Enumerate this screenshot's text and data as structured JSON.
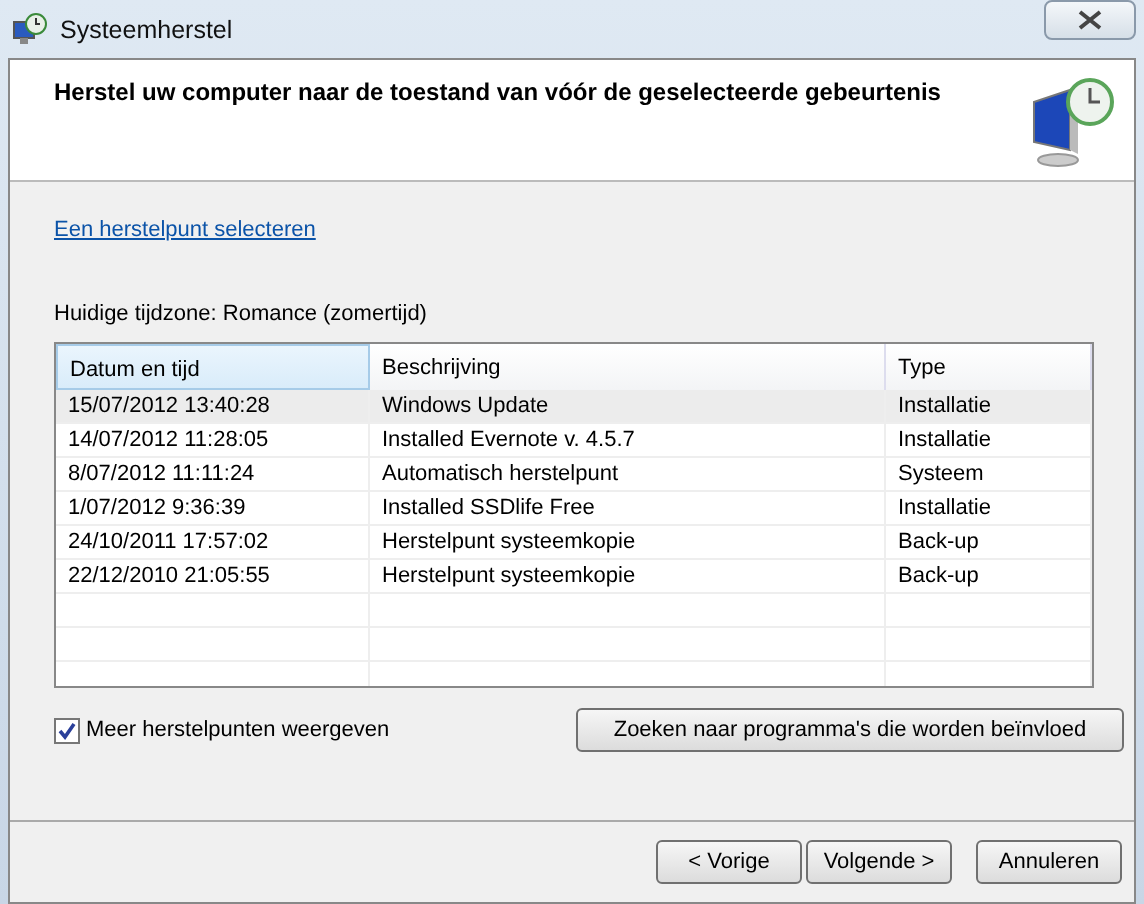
{
  "window": {
    "title": "Systeemherstel"
  },
  "heading": "Herstel uw computer naar de toestand van vóór de geselecteerde gebeurtenis",
  "link": "Een herstelpunt selecteren",
  "timezone": "Huidige tijdzone: Romance (zomertijd)",
  "table": {
    "columns": [
      {
        "label": "Datum en tijd",
        "sorted": true
      },
      {
        "label": "Beschrijving",
        "sorted": false
      },
      {
        "label": "Type",
        "sorted": false
      }
    ],
    "rows": [
      {
        "cells": [
          "15/07/2012 13:40:28",
          "Windows Update",
          "Installatie"
        ],
        "selected": true
      },
      {
        "cells": [
          "14/07/2012 11:28:05",
          "Installed Evernote v. 4.5.7",
          "Installatie"
        ],
        "selected": false
      },
      {
        "cells": [
          "8/07/2012 11:11:24",
          "Automatisch herstelpunt",
          "Systeem"
        ],
        "selected": false
      },
      {
        "cells": [
          "1/07/2012 9:36:39",
          "Installed SSDlife Free",
          "Installatie"
        ],
        "selected": false
      },
      {
        "cells": [
          "24/10/2011 17:57:02",
          "Herstelpunt systeemkopie",
          "Back-up"
        ],
        "selected": false
      },
      {
        "cells": [
          "22/12/2010 21:05:55",
          "Herstelpunt systeemkopie",
          "Back-up"
        ],
        "selected": false
      }
    ]
  },
  "more_points": {
    "label": "Meer herstelpunten weergeven",
    "checked": true
  },
  "scan_button": "Zoeken naar programma's die worden beïnvloed",
  "buttons": [
    "< Vorige",
    "Volgende >",
    "Annuleren"
  ]
}
